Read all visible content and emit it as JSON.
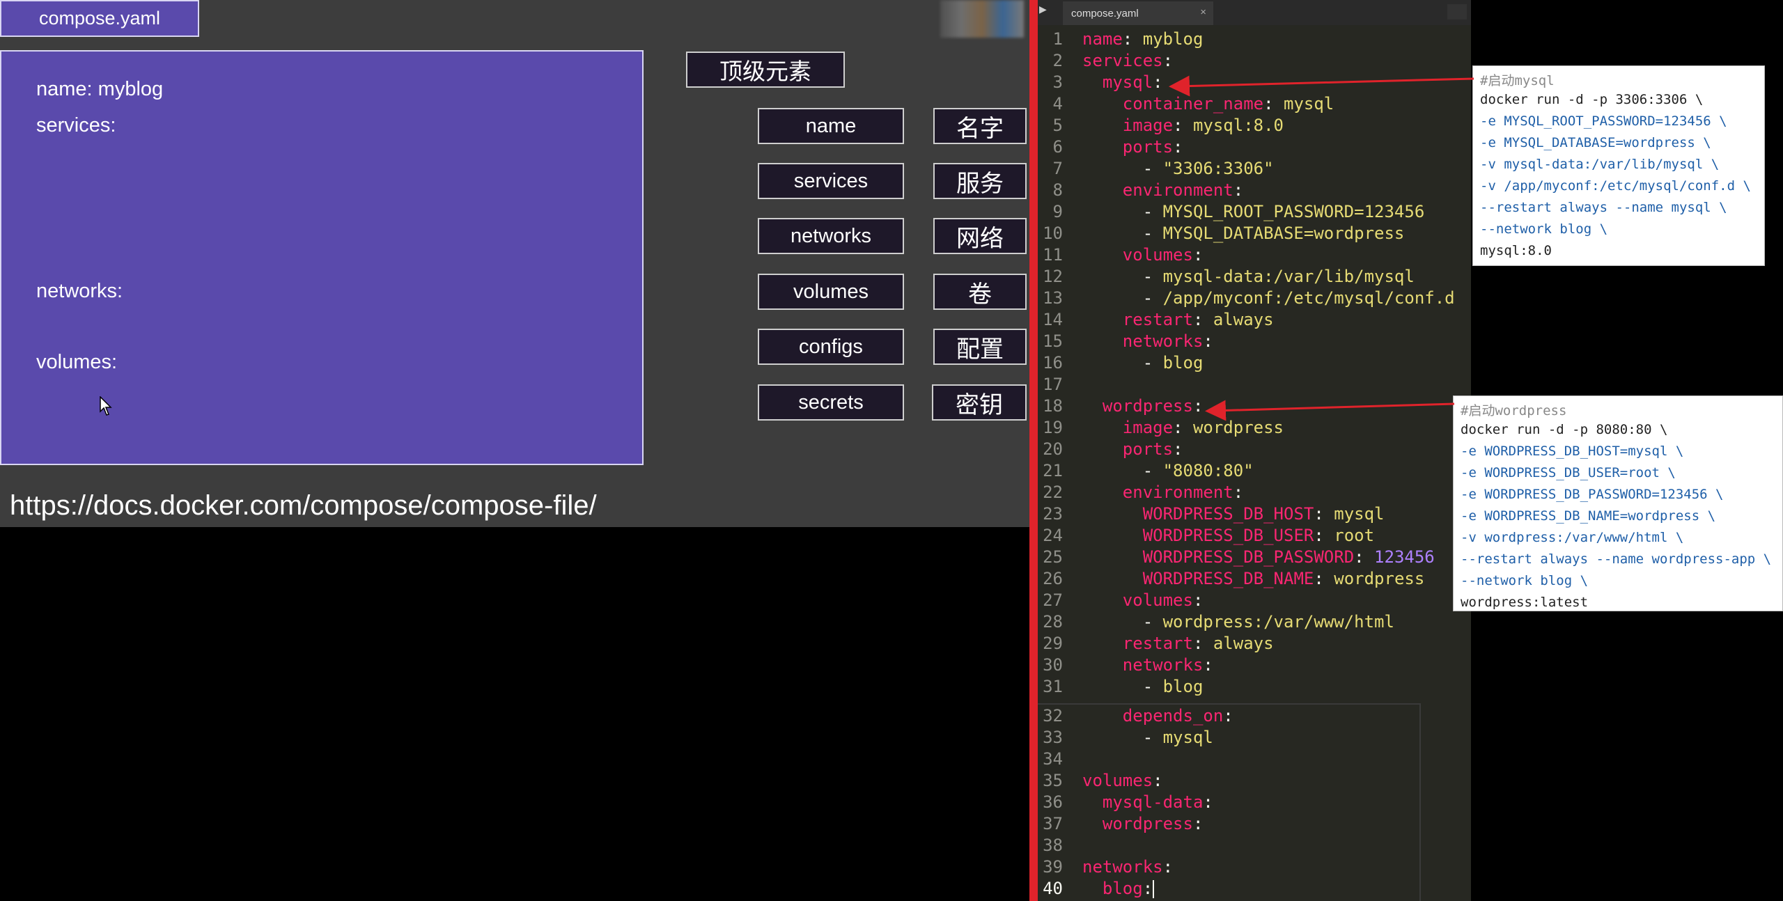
{
  "slide": {
    "file_tab": "compose.yaml",
    "panel_keys": [
      "name: myblog",
      "services:",
      "networks:",
      "volumes:"
    ],
    "top_element_label": "顶级元素",
    "elements": [
      {
        "en": "name",
        "zh": "名字"
      },
      {
        "en": "services",
        "zh": "服务"
      },
      {
        "en": "networks",
        "zh": "网络"
      },
      {
        "en": "volumes",
        "zh": "卷"
      },
      {
        "en": "configs",
        "zh": "配置"
      },
      {
        "en": "secrets",
        "zh": "密钥"
      }
    ],
    "url": "https://docs.docker.com/compose/compose-file/"
  },
  "editor": {
    "tab_label": "compose.yaml",
    "tab_close": "×",
    "play_icon": "▶",
    "lines": [
      "1",
      "2",
      "3",
      "4",
      "5",
      "6",
      "7",
      "8",
      "9",
      "10",
      "11",
      "12",
      "13",
      "14",
      "15",
      "16",
      "17",
      "18",
      "19",
      "20",
      "21",
      "22",
      "23",
      "24",
      "25",
      "26",
      "27",
      "28",
      "29",
      "30",
      "31",
      "32",
      "33",
      "34",
      "35",
      "36",
      "37",
      "38",
      "39",
      "40"
    ]
  },
  "mysql_popup": {
    "comment": "#启动mysql",
    "lines": [
      "docker run -d -p 3306:3306 \\",
      "-e MYSQL_ROOT_PASSWORD=123456 \\",
      "-e MYSQL_DATABASE=wordpress \\",
      "-v mysql-data:/var/lib/mysql \\",
      "-v /app/myconf:/etc/mysql/conf.d \\",
      "--restart always --name mysql \\",
      "--network blog \\",
      "mysql:8.0"
    ]
  },
  "wordpress_popup": {
    "comment": "#启动wordpress",
    "lines": [
      "docker run -d -p 8080:80 \\",
      "-e WORDPRESS_DB_HOST=mysql \\",
      "-e WORDPRESS_DB_USER=root \\",
      "-e WORDPRESS_DB_PASSWORD=123456 \\",
      "-e WORDPRESS_DB_NAME=wordpress \\",
      "-v wordpress:/var/www/html \\",
      "--restart always --name wordpress-app \\",
      "--network blog \\",
      "wordpress:latest"
    ]
  },
  "colors": {
    "slide_panel": "#5a4aac",
    "editor_bg": "#272822",
    "keyword": "#f92672",
    "string": "#e6db74",
    "number": "#ae81ff",
    "arrow": "#e0232b"
  }
}
